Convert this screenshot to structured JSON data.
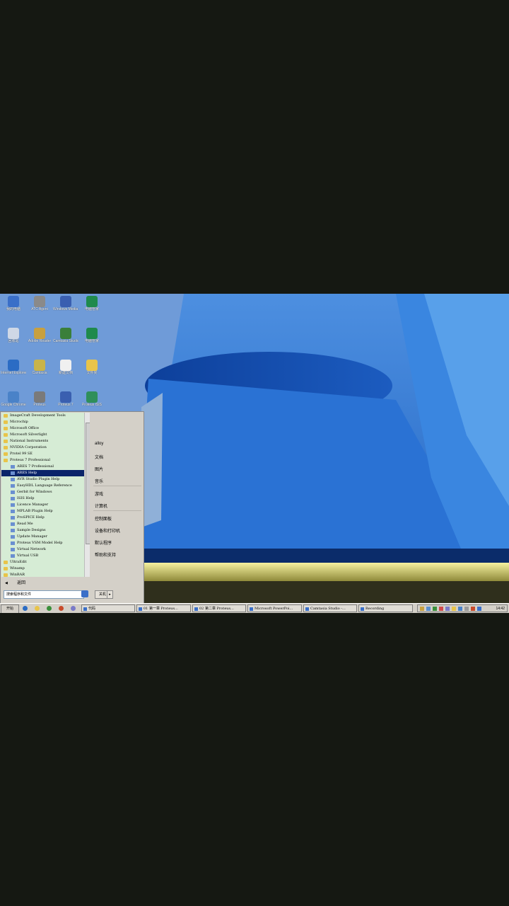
{
  "desktop_icons": [
    {
      "label": "我的电脑",
      "icon": "computer-icon",
      "color": "#3a6fc8"
    },
    {
      "label": "ATC Agent",
      "icon": "agent-icon",
      "color": "#8a8a8a"
    },
    {
      "label": "Windows Media Player",
      "icon": "media-icon",
      "color": "#3a5fb0"
    },
    {
      "label": "电脑管家",
      "icon": "app-icon",
      "color": "#1f8a4c"
    },
    {
      "label": "回收站",
      "icon": "recycle-bin-icon",
      "color": "#cfd8e6"
    },
    {
      "label": "Adobe Reader",
      "icon": "reader-icon",
      "color": "#c8a040"
    },
    {
      "label": "Camtasia Studio",
      "icon": "camtasia-icon",
      "color": "#3a7f3a"
    },
    {
      "label": "电脑管家",
      "icon": "app-icon",
      "color": "#1f8a4c"
    },
    {
      "label": "Internet Explorer",
      "icon": "ie-icon",
      "color": "#2b6cc4"
    },
    {
      "label": "Camtasia",
      "icon": "camtasia-icon",
      "color": "#c9b44a"
    },
    {
      "label": "新建文档",
      "icon": "document-icon",
      "color": "#f0f0f0"
    },
    {
      "label": "文件夹",
      "icon": "folder-icon",
      "color": "#e8c44a"
    },
    {
      "label": "Google Chrome",
      "icon": "browser-icon",
      "color": "#4a82c8"
    },
    {
      "label": "Proteus",
      "icon": "proteus-icon",
      "color": "#7a7a7a"
    },
    {
      "label": "Proteus 7",
      "icon": "proteus-icon",
      "color": "#3a5fb0"
    },
    {
      "label": "Proteus ISIS",
      "icon": "isis-icon",
      "color": "#2f8f5a"
    }
  ],
  "start_menu": {
    "programs": [
      {
        "label": "ImageCraft Development Tools",
        "sub": false,
        "selected": false
      },
      {
        "label": "Microchip",
        "sub": false,
        "selected": false
      },
      {
        "label": "Microsoft Office",
        "sub": false,
        "selected": false
      },
      {
        "label": "Microsoft Silverlight",
        "sub": false,
        "selected": false
      },
      {
        "label": "National Instruments",
        "sub": false,
        "selected": false
      },
      {
        "label": "NVIDIA Corporation",
        "sub": false,
        "selected": false
      },
      {
        "label": "Protel 99 SE",
        "sub": false,
        "selected": false
      },
      {
        "label": "Proteus 7 Professional",
        "sub": false,
        "selected": false
      },
      {
        "label": "ARES 7 Professional",
        "sub": true,
        "selected": false
      },
      {
        "label": "ARES Help",
        "sub": true,
        "selected": true
      },
      {
        "label": "AVR Studio Plugin Help",
        "sub": true,
        "selected": false
      },
      {
        "label": "EasyHDL Language Reference",
        "sub": true,
        "selected": false
      },
      {
        "label": "Gerbit for Windows",
        "sub": true,
        "selected": false
      },
      {
        "label": "ISIS Help",
        "sub": true,
        "selected": false
      },
      {
        "label": "Licence Manager",
        "sub": true,
        "selected": false
      },
      {
        "label": "MPLAB Plugin Help",
        "sub": true,
        "selected": false
      },
      {
        "label": "ProSPICE Help",
        "sub": true,
        "selected": false
      },
      {
        "label": "Read Me",
        "sub": true,
        "selected": false
      },
      {
        "label": "Sample Designs",
        "sub": true,
        "selected": false
      },
      {
        "label": "Update Manager",
        "sub": true,
        "selected": false
      },
      {
        "label": "Proteus VSM Model Help",
        "sub": true,
        "selected": false
      },
      {
        "label": "Virtual Network",
        "sub": true,
        "selected": false
      },
      {
        "label": "Virtual USB",
        "sub": true,
        "selected": false
      },
      {
        "label": "UltraEdit",
        "sub": false,
        "selected": false
      },
      {
        "label": "Winamp",
        "sub": false,
        "selected": false
      },
      {
        "label": "WinRAR",
        "sub": false,
        "selected": false
      }
    ],
    "back_label": "返回",
    "search_placeholder": "搜索程序和文件",
    "right_items": [
      {
        "label": "alloy"
      },
      {
        "label": "文档"
      },
      {
        "label": "图片"
      },
      {
        "label": "音乐"
      },
      {
        "label": "游戏"
      },
      {
        "label": "计算机"
      },
      {
        "label": "控制面板"
      },
      {
        "label": "设备和打印机"
      },
      {
        "label": "默认程序"
      },
      {
        "label": "帮助和支持"
      }
    ],
    "shutdown_label": "关机",
    "shutdown_arrow": "▸"
  },
  "taskbar": {
    "start_label": "开始",
    "quick_launch": [
      "ie-icon",
      "explorer-icon",
      "media-icon",
      "adobe-icon",
      "app-icon"
    ],
    "tasks": [
      {
        "label": "代码"
      },
      {
        "label": "01 第一章 Proteus..."
      },
      {
        "label": "02 第二章  Proteus..."
      },
      {
        "label": "Microsoft PowerPoi..."
      },
      {
        "label": "Camtasia Studio -..."
      },
      {
        "label": "Recording"
      }
    ],
    "clock": "14:42"
  },
  "colors": {
    "wallpaper_sky": "#5d8fd6",
    "selection": "#0a246a",
    "menu_bg": "#d6ecd5"
  }
}
